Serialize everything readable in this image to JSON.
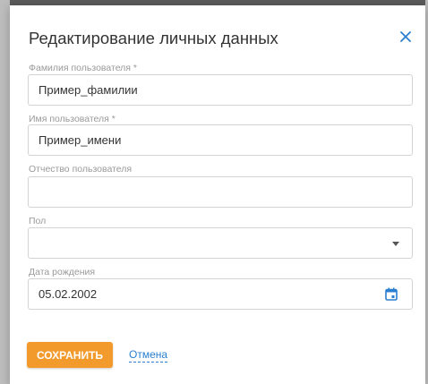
{
  "dialog": {
    "title": "Редактирование личных данных",
    "close_icon": "close-icon"
  },
  "fields": {
    "last_name": {
      "label": "Фамилия пользователя *",
      "value": "Пример_фамилии"
    },
    "first_name": {
      "label": "Имя пользователя *",
      "value": "Пример_имени"
    },
    "middle_name": {
      "label": "Отчество пользователя",
      "value": ""
    },
    "gender": {
      "label": "Пол",
      "value": ""
    },
    "birth_date": {
      "label": "Дата рождения",
      "value": "05.02.2002"
    }
  },
  "actions": {
    "save_label": "СОХРАНИТЬ",
    "cancel_label": "Отмена"
  },
  "colors": {
    "accent_blue": "#2b7fd0",
    "save_orange": "#f39a2c"
  }
}
